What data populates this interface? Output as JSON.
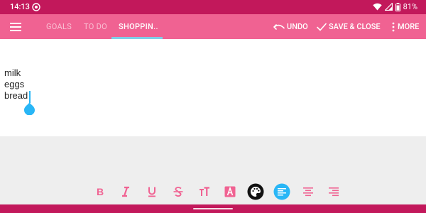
{
  "colors": {
    "status_bar": "#c2185b",
    "toolbar": "#f06292",
    "tab_indicator": "#7fcfe8",
    "format_icon": "#f06292",
    "cursor": "#29b6f6",
    "editor_bg": "#ffffff",
    "panel_bg": "#eeeeee"
  },
  "status_bar": {
    "time": "14:13",
    "battery": "81%",
    "icons": [
      "notification-circle-icon",
      "wifi-icon",
      "signal-icon",
      "battery-icon"
    ]
  },
  "toolbar": {
    "menu_icon": "hamburger-menu-icon",
    "tabs": [
      {
        "label": "GOALS",
        "active": false
      },
      {
        "label": "TO DO",
        "active": false
      },
      {
        "label": "SHOPPIN..",
        "active": true
      }
    ],
    "actions": {
      "undo": "UNDO",
      "save_close": "SAVE & CLOSE",
      "more": "MORE"
    }
  },
  "editor": {
    "lines": [
      "milk",
      "eggs",
      "bread"
    ]
  },
  "format_toolbar": {
    "buttons": [
      {
        "name": "bold-icon",
        "active": false
      },
      {
        "name": "italic-icon",
        "active": false
      },
      {
        "name": "underline-icon",
        "active": false
      },
      {
        "name": "strikethrough-icon",
        "active": false
      },
      {
        "name": "text-size-icon",
        "active": false
      },
      {
        "name": "text-color-icon",
        "active": false
      },
      {
        "name": "palette-icon",
        "active": false
      },
      {
        "name": "align-left-icon",
        "active": true
      },
      {
        "name": "align-center-icon",
        "active": false
      },
      {
        "name": "align-right-icon",
        "active": false
      }
    ]
  }
}
